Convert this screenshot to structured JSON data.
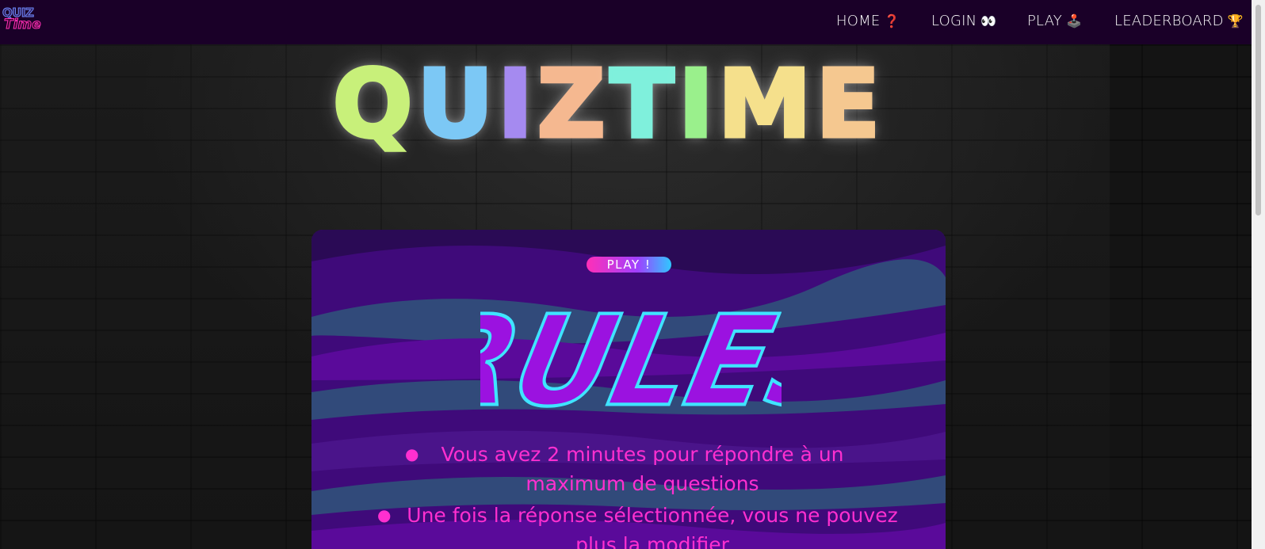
{
  "logo": {
    "line1": "QUIZ",
    "line2": "Time"
  },
  "nav": {
    "items": [
      {
        "label": "HOME",
        "emoji": "❓"
      },
      {
        "label": "LOGIN",
        "emoji": "👀"
      },
      {
        "label": "PLAY",
        "emoji": "🕹️"
      },
      {
        "label": "LEADERBOARD",
        "emoji": "🏆"
      }
    ]
  },
  "hero": {
    "letters": [
      "Q",
      "U",
      "I",
      "Z",
      "T",
      "I",
      "M",
      "E"
    ],
    "colors": [
      "#c8f07a",
      "#7cc8f5",
      "#a58af0",
      "#f5b890",
      "#7ff0dc",
      "#9af08c",
      "#f5e08c",
      "#f5c890"
    ]
  },
  "card": {
    "play_label": "PLAY !",
    "rules_title": "RULES",
    "rules": [
      "Vous avez 2 minutes pour répondre à un maximum de questions",
      "Une fois la réponse sélectionnée, vous ne pouvez plus la modifier"
    ]
  },
  "colors": {
    "navbar": "#1a0028",
    "accent_pink": "#ff2fd0",
    "card_bg": "#3f0a7a"
  }
}
